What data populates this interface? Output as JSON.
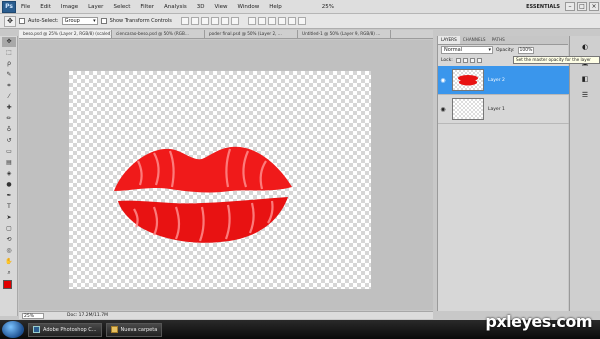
{
  "app": {
    "logo": "Ps",
    "menu": [
      "File",
      "Edit",
      "Image",
      "Layer",
      "Select",
      "Filter",
      "Analysis",
      "3D",
      "View",
      "Window",
      "Help"
    ],
    "zoom_menu": "25%",
    "workspace": "ESSENTIALS"
  },
  "options_bar": {
    "auto_select_label": "Auto-Select:",
    "auto_select_value": "Group",
    "show_transform_label": "Show Transform Controls"
  },
  "documents": {
    "tabs": [
      {
        "label": "beso.psd @ 25% (Layer 2, RGB/8) (scaled)"
      },
      {
        "label": "ciencarao-beso.psd @ 50% (RGB..."
      },
      {
        "label": "poder final.psd @ 50% (Layer 2, ..."
      },
      {
        "label": "Untitled-1 @ 50% (Layer 9, RGB/8) ..."
      }
    ],
    "zoom": "25%",
    "doc_size": "Doc: 17.2M/11.7M"
  },
  "layers_panel": {
    "tabs": [
      "LAYERS",
      "CHANNELS",
      "PATHS"
    ],
    "blend_mode": "Normal",
    "opacity_label": "Opacity:",
    "opacity_value": "100%",
    "lock_label": "Lock:",
    "fill_label": "Fill:",
    "tooltip": "Set the master opacity for the layer",
    "layers": [
      {
        "name": "Layer 2",
        "selected": true
      },
      {
        "name": "Layer 1",
        "selected": false
      }
    ]
  },
  "taskbar": {
    "items": [
      "Adobe Photoshop C...",
      "Nueva carpeta"
    ]
  },
  "watermark": "pxleyes.com",
  "colors": {
    "foreground": "#e00000",
    "selection": "#3a96ec",
    "lip_red": "#f01a1a"
  }
}
